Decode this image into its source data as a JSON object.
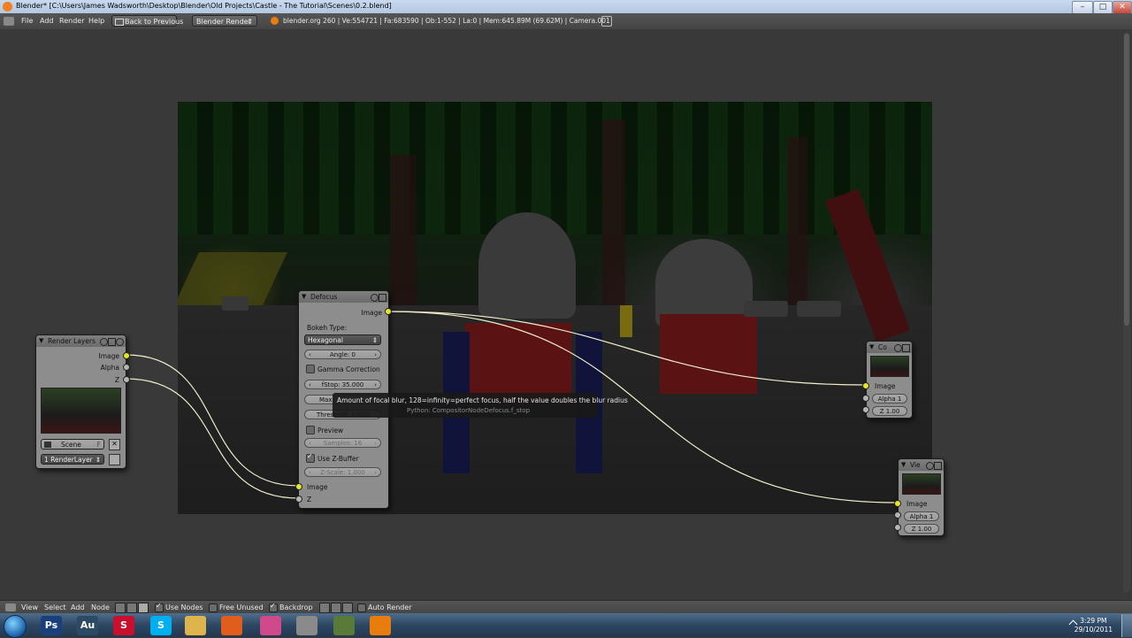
{
  "window": {
    "title": "Blender* [C:\\Users\\James Wadsworth\\Desktop\\Blender\\Old Projects\\Castle - The Tutorial\\Scenes\\0.2.blend]",
    "controls": [
      "–",
      "□",
      "✕"
    ]
  },
  "info_header": {
    "menus": [
      "File",
      "Add",
      "Render",
      "Help"
    ],
    "back_button": "Back to Previous",
    "render_engine": "Blender Render",
    "stats": "blender.org 260 | Ve:554721 | Fa:683590 | Ob:1-552 | La:0 | Mem:645.89M (69.62M) | Camera.001"
  },
  "nodes": {
    "render_layers": {
      "title": "Render Layers",
      "outputs": [
        "Image",
        "Alpha",
        "Z"
      ],
      "scene": "Scene",
      "scene_users": "F",
      "layer": "1 RenderLayer"
    },
    "defocus": {
      "title": "Defocus",
      "output": "Image",
      "bokeh_label": "Bokeh Type:",
      "bokeh_value": "Hexagonal",
      "angle": "Angle: 0",
      "gamma": "Gamma Correction",
      "fstop": "fStop: 35.000",
      "maxblur_partial": "Max",
      "threshold": "Threshold: 1.000",
      "preview": "Preview",
      "samples": "Samples: 16",
      "use_zbuffer": "Use Z-Buffer",
      "zscale": "Z-Scale: 1.000",
      "inputs": [
        "Image",
        "Z"
      ]
    },
    "composite": {
      "title": "Co",
      "input": "Image",
      "alpha": "Alpha 1",
      "z": "Z 1.00"
    },
    "viewer": {
      "title": "Vie",
      "input": "Image",
      "alpha": "Alpha 1",
      "z": "Z 1.00"
    }
  },
  "tooltip": {
    "text": "Amount of focal blur, 128=infinity=perfect focus, half the value doubles the blur radius",
    "python": "Python: CompositorNodeDefocus.f_stop"
  },
  "bottom_header": {
    "menus": [
      "View",
      "Select",
      "Add",
      "Node"
    ],
    "use_nodes": "Use Nodes",
    "free_unused": "Free Unused",
    "backdrop": "Backdrop",
    "auto_render": "Auto Render"
  },
  "taskbar": {
    "apps": [
      {
        "name": "Ps",
        "color": "#1b3f7a"
      },
      {
        "name": "Au",
        "color": "#2c4a63"
      },
      {
        "name": "S",
        "color": "#c8102e"
      },
      {
        "name": "S",
        "color": "#00aff0"
      },
      {
        "name": "",
        "color": "#e0b44c"
      },
      {
        "name": "",
        "color": "#e05d1b"
      },
      {
        "name": "",
        "color": "#cf4a8a"
      },
      {
        "name": "",
        "color": "#8a8a8a"
      },
      {
        "name": "",
        "color": "#5a7a3a"
      },
      {
        "name": "",
        "color": "#e87d0d"
      }
    ],
    "time": "3:29 PM",
    "date": "29/10/2011"
  }
}
